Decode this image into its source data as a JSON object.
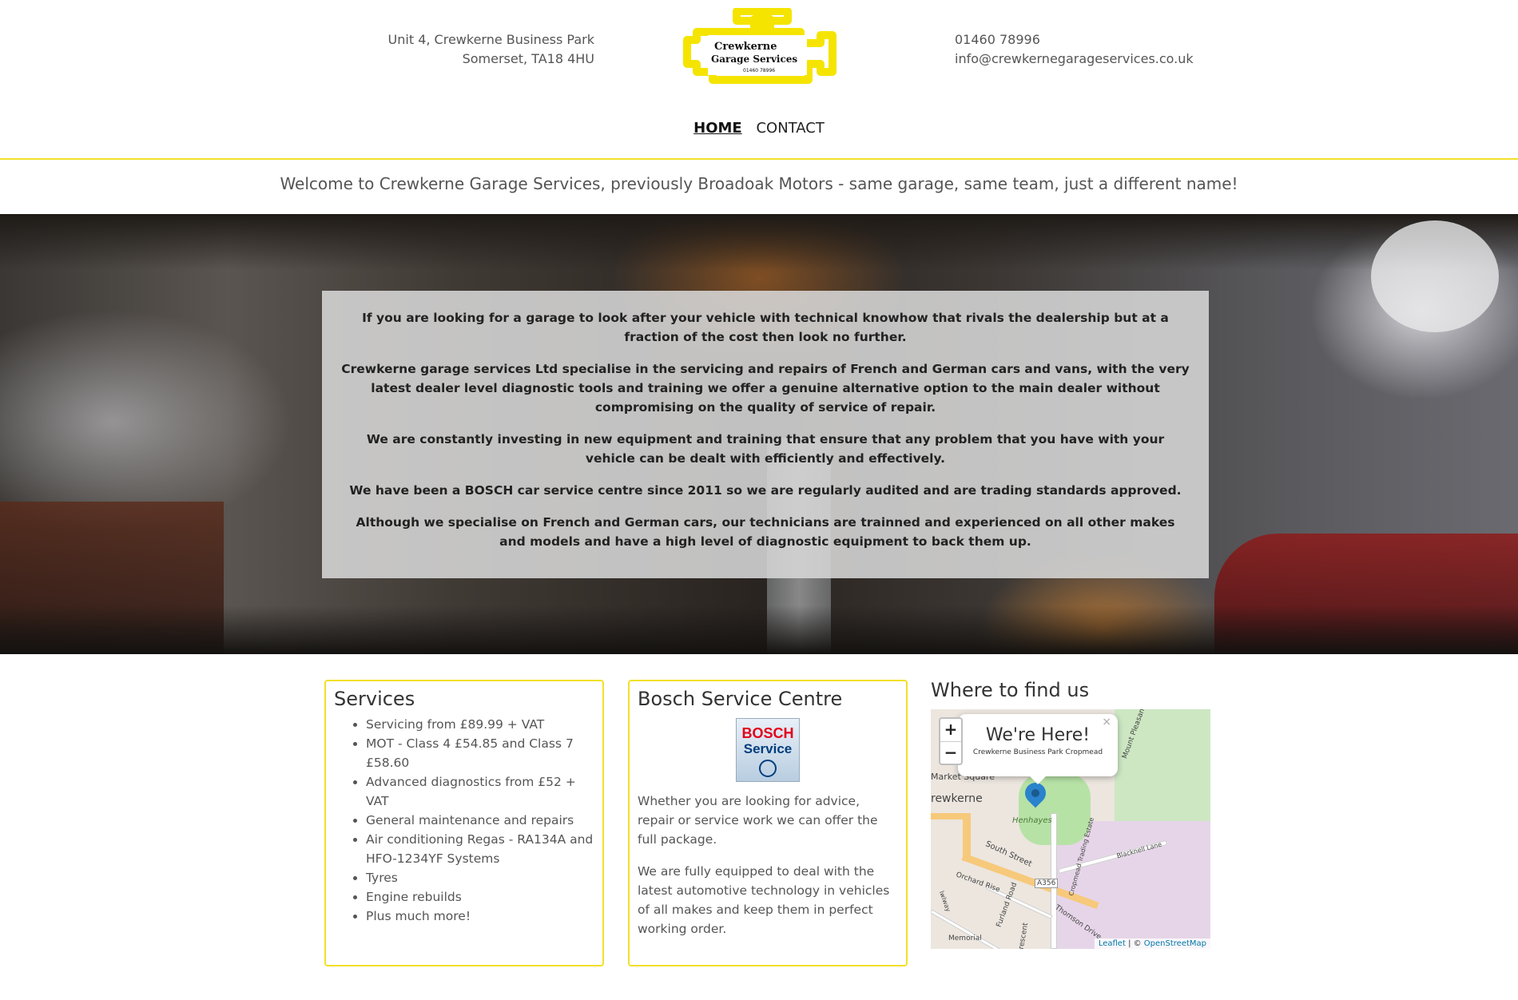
{
  "header": {
    "address_line1": "Unit 4, Crewkerne Business Park",
    "address_line2": "Somerset, TA18 4HU",
    "phone": "01460 78996",
    "email": "info@crewkernegarageservices.co.uk",
    "logo_line1": "Crewkerne",
    "logo_line2": "Garage Services",
    "logo_phone": "01460 78996"
  },
  "nav": {
    "home": "HOME",
    "contact": "CONTACT"
  },
  "welcome": "Welcome to Crewkerne Garage Services, previously Broadoak Motors - same garage, same team, just a different name!",
  "intro": {
    "p1": "If you are looking for a garage to look after your vehicle with technical knowhow that rivals the dealership but at a fraction of the cost then look no further.",
    "p2": "Crewkerne garage services Ltd specialise in the servicing and repairs of French and German cars and vans, with the very latest dealer level diagnostic tools and training we offer a genuine alternative option to the main dealer without compromising on the quality of service of repair.",
    "p3": "We are constantly investing in new equipment and training that ensure that any problem that you have with your vehicle can be dealt with efficiently and effectively.",
    "p4": "We have been a BOSCH car service centre since 2011 so we are regularly audited and are trading standards approved.",
    "p5": "Although we specialise on French and German cars, our technicians are trainned and experienced on all other makes and models and have a high level of diagnostic equipment to back them up."
  },
  "services": {
    "title": "Services",
    "items": [
      "Servicing from £89.99 + VAT",
      "MOT - Class 4 £54.85 and Class 7 £58.60",
      "Advanced diagnostics from £52 + VAT",
      "General maintenance and repairs",
      "Air conditioning Regas - RA134A and HFO-1234YF Systems",
      "Tyres",
      "Engine rebuilds",
      "Plus much more!"
    ]
  },
  "bosch": {
    "title": "Bosch Service Centre",
    "logo_brand": "BOSCH",
    "logo_service": "Service",
    "p1": "Whether you are looking for advice, repair or service work we can offer the full package.",
    "p2": "We are fully equipped to deal with the latest automotive technology in vehicles of all makes and keep them in perfect working order."
  },
  "find": {
    "title": "Where to find us",
    "zoom_in": "+",
    "zoom_out": "−",
    "popup_title": "We're Here!",
    "popup_subtitle": "Crewkerne Business Park Cropmead",
    "popup_close": "×",
    "map_labels": {
      "market_square": "Market Square",
      "crewkerne": "rewkerne",
      "henhayes": "Henhayes",
      "south_street": "South Street",
      "a356": "A356",
      "orchard_rise": "Orchard Rise",
      "furland_road": "Furland Road",
      "thomson_drive": "Thomson Drive",
      "blacknell_lane": "Blacknell Lane",
      "cropmead_estate": "Cropmead Trading Estate",
      "mount_pleasant": "Mount Pleasant",
      "memorial": "Memorial",
      "crescent": "Crescent",
      "lowlway": "lwlway"
    },
    "attribution_leaflet": "Leaflet",
    "attribution_sep": " | © ",
    "attribution_osm": "OpenStreetMap"
  }
}
